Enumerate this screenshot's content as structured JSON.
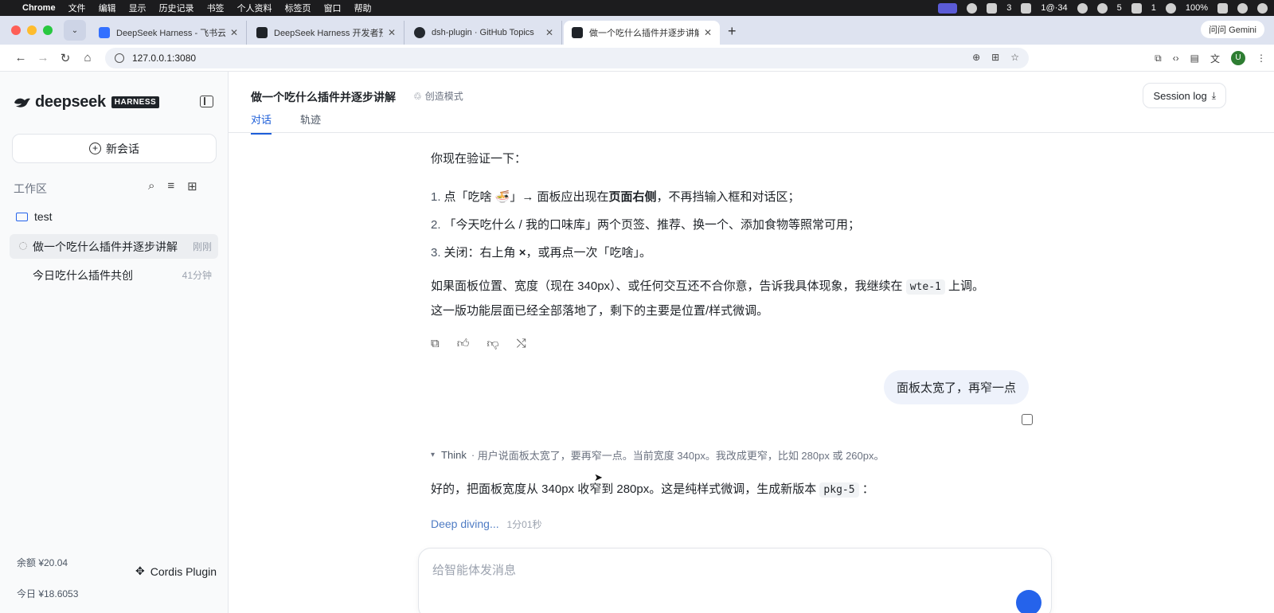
{
  "menubar": {
    "app": "Chrome",
    "items": [
      "文件",
      "编辑",
      "显示",
      "历史记录",
      "书签",
      "个人资料",
      "标签页",
      "窗口",
      "帮助"
    ],
    "tray_texts": [
      "3",
      "1@·34",
      "5",
      "1",
      "100%"
    ]
  },
  "browser": {
    "tabs": [
      {
        "title": "DeepSeek Harness - 飞书云文"
      },
      {
        "title": "DeepSeek Harness 开发者预览"
      },
      {
        "title": "dsh-plugin · GitHub Topics"
      },
      {
        "title": "做一个吃什么插件并逐步讲解 -"
      }
    ],
    "url": "127.0.0.1:3080",
    "ask_gemini": "问问 Gemini",
    "profile_initial": "U"
  },
  "sidebar": {
    "logo": "deepseek",
    "badge": "HARNESS",
    "new_chat": "新会话",
    "workspace_label": "工作区",
    "folder": "test",
    "sessions": [
      {
        "title": "做一个吃什么插件并逐步讲解",
        "time": "刚刚"
      },
      {
        "title": "今日吃什么插件共创",
        "time": "41分钟"
      }
    ],
    "balance": "余额 ¥20.04",
    "today": "今日 ¥18.6053",
    "plugin": "Cordis Plugin"
  },
  "chat": {
    "title": "做一个吃什么插件并逐步讲解",
    "mode": "创造模式",
    "tabs": [
      "对话",
      "轨迹"
    ],
    "session_log": "Session log",
    "assistant_intro": "你现在验证一下：",
    "steps": [
      {
        "num": "1.",
        "pre": "点「吃啥 🍜」→ 面板应出现在",
        "bold": "页面右侧",
        "post": "，不再挡输入框和对话区；"
      },
      {
        "num": "2.",
        "pre": "「今天吃什么 / 我的口味库」两个页签、推荐、换一个、添加食物等照常可用；",
        "bold": "",
        "post": ""
      },
      {
        "num": "3.",
        "pre": "关闭：右上角 ",
        "bold": "×",
        "post": "，或再点一次「吃啥」。"
      }
    ],
    "para_a": "如果面板位置、宽度（现在 340px）、或任何交互还不合你意，告诉我具体现象，我继续在",
    "para_code": "wte-1",
    "para_b": "上调。",
    "para_line2": "这一版功能层面已经全部落地了，剩下的主要是位置/样式微调。",
    "user_message": "面板太宽了，再窄一点",
    "think_label": "Think",
    "think_text": "用户说面板太宽了，要再窄一点。当前宽度 340px。我改成更窄，比如 280px 或 260px。",
    "reply_a": "好的，把面板宽度从 340px 收窄到 280px。这是纯样式微调，生成新版本",
    "reply_code": "pkg-5",
    "reply_b": "：",
    "deep_diving": "Deep diving...",
    "elapsed": "1分01秒",
    "composer_placeholder": "给智能体发消息"
  }
}
